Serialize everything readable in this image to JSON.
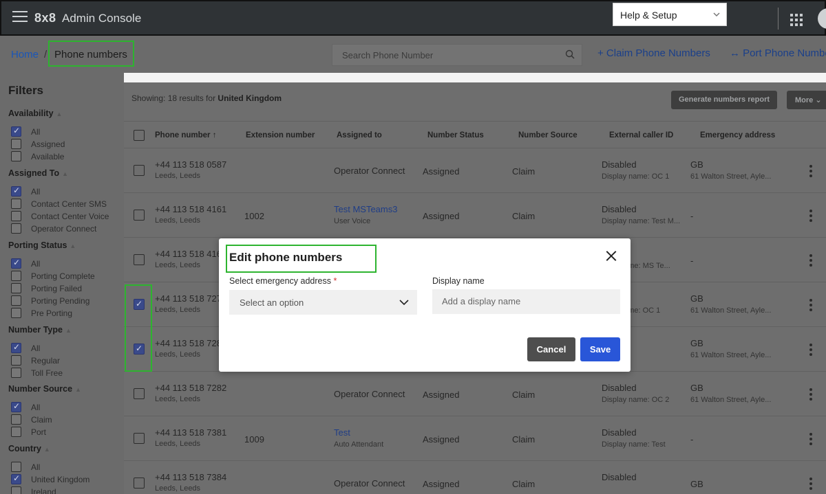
{
  "topbar": {
    "brand": "8x8",
    "app_name": "Admin Console",
    "help_menu": "Help & Setup"
  },
  "breadcrumb": {
    "home": "Home",
    "separator": "/",
    "current": "Phone numbers"
  },
  "search": {
    "placeholder": "Search Phone Number"
  },
  "actions": {
    "claim": "+ Claim Phone Numbers",
    "port": "↔ Port Phone Numbers"
  },
  "filters": {
    "title": "Filters",
    "groups": [
      {
        "title": "Availability",
        "items": [
          {
            "label": "All",
            "checked": true
          },
          {
            "label": "Assigned",
            "checked": false
          },
          {
            "label": "Available",
            "checked": false
          }
        ]
      },
      {
        "title": "Assigned To",
        "items": [
          {
            "label": "All",
            "checked": true
          },
          {
            "label": "Contact Center SMS",
            "checked": false
          },
          {
            "label": "Contact Center Voice",
            "checked": false
          },
          {
            "label": "Operator Connect",
            "checked": false
          }
        ]
      },
      {
        "title": "Porting Status",
        "items": [
          {
            "label": "All",
            "checked": true
          },
          {
            "label": "Porting Complete",
            "checked": false
          },
          {
            "label": "Porting Failed",
            "checked": false
          },
          {
            "label": "Porting Pending",
            "checked": false
          },
          {
            "label": "Pre Porting",
            "checked": false
          }
        ]
      },
      {
        "title": "Number Type",
        "items": [
          {
            "label": "All",
            "checked": true
          },
          {
            "label": "Regular",
            "checked": false
          },
          {
            "label": "Toll Free",
            "checked": false
          }
        ]
      },
      {
        "title": "Number Source",
        "items": [
          {
            "label": "All",
            "checked": true
          },
          {
            "label": "Claim",
            "checked": false
          },
          {
            "label": "Port",
            "checked": false
          }
        ]
      },
      {
        "title": "Country",
        "items": [
          {
            "label": "All",
            "checked": false
          },
          {
            "label": "United Kingdom",
            "checked": true
          },
          {
            "label": "Ireland",
            "checked": false
          }
        ]
      }
    ]
  },
  "results": {
    "showing_prefix": "Showing: 18 results for",
    "country": "United Kingdom",
    "generate_report": "Generate numbers report",
    "more": "More"
  },
  "table": {
    "columns": [
      "Phone number",
      "Extension number",
      "Assigned to",
      "Number Status",
      "Number Source",
      "External caller ID",
      "Emergency address"
    ],
    "sort_indicator": "↑",
    "rows": [
      {
        "checked": false,
        "phone": "+44 113 518 0587",
        "city": "Leeds, Leeds",
        "ext": "",
        "assigned": "Operator Connect",
        "assigned_sub": "",
        "assigned_link": false,
        "status": "Assigned",
        "source": "Claim",
        "caller": "Disabled",
        "caller_sub": "Display name: OC 1",
        "emerg": "GB",
        "emerg_sub": "61 Walton Street, Ayle..."
      },
      {
        "checked": false,
        "phone": "+44 113 518 4161",
        "city": "Leeds, Leeds",
        "ext": "1002",
        "assigned": "Test MSTeams3",
        "assigned_sub": "User Voice",
        "assigned_link": true,
        "status": "Assigned",
        "source": "Claim",
        "caller": "Disabled",
        "caller_sub": "Display name: Test M...",
        "emerg": "-",
        "emerg_sub": ""
      },
      {
        "checked": false,
        "phone": "+44 113 518 416",
        "city": "Leeds, Leeds",
        "ext": "",
        "assigned": "",
        "assigned_sub": "",
        "assigned_link": false,
        "status": "",
        "source": "",
        "caller": "",
        "caller_sub": "name: MS Te...",
        "emerg": "-",
        "emerg_sub": ""
      },
      {
        "checked": true,
        "phone": "+44 113 518 727",
        "city": "Leeds, Leeds",
        "ext": "",
        "assigned": "",
        "assigned_sub": "",
        "assigned_link": false,
        "status": "",
        "source": "",
        "caller": "",
        "caller_sub": "name: OC 1",
        "emerg": "GB",
        "emerg_sub": "61 Walton Street, Ayle..."
      },
      {
        "checked": true,
        "phone": "+44 113 518 728",
        "city": "Leeds, Leeds",
        "ext": "",
        "assigned": "",
        "assigned_sub": "",
        "assigned_link": false,
        "status": "",
        "source": "",
        "caller": "",
        "caller_sub": "",
        "emerg": "GB",
        "emerg_sub": "61 Walton Street, Ayle..."
      },
      {
        "checked": false,
        "phone": "+44 113 518 7282",
        "city": "Leeds, Leeds",
        "ext": "",
        "assigned": "Operator Connect",
        "assigned_sub": "",
        "assigned_link": false,
        "status": "Assigned",
        "source": "Claim",
        "caller": "Disabled",
        "caller_sub": "Display name: OC 2",
        "emerg": "GB",
        "emerg_sub": "61 Walton Street, Ayle..."
      },
      {
        "checked": false,
        "phone": "+44 113 518 7381",
        "city": "Leeds, Leeds",
        "ext": "1009",
        "assigned": "Test",
        "assigned_sub": "Auto Attendant",
        "assigned_link": true,
        "status": "Assigned",
        "source": "Claim",
        "caller": "Disabled",
        "caller_sub": "Display name: Test",
        "emerg": "-",
        "emerg_sub": ""
      },
      {
        "checked": false,
        "phone": "+44 113 518 7384",
        "city": "Leeds, Leeds",
        "ext": "",
        "assigned": "Operator Connect",
        "assigned_sub": "",
        "assigned_link": false,
        "status": "Assigned",
        "source": "Claim",
        "caller": "Disabled",
        "caller_sub": "",
        "emerg": "GB",
        "emerg_sub": ""
      }
    ]
  },
  "modal": {
    "title": "Edit phone numbers",
    "emergency_label": "Select emergency address",
    "required_mark": "*",
    "emergency_placeholder": "Select an option",
    "display_label": "Display name",
    "display_placeholder": "Add a display name",
    "cancel": "Cancel",
    "save": "Save"
  }
}
